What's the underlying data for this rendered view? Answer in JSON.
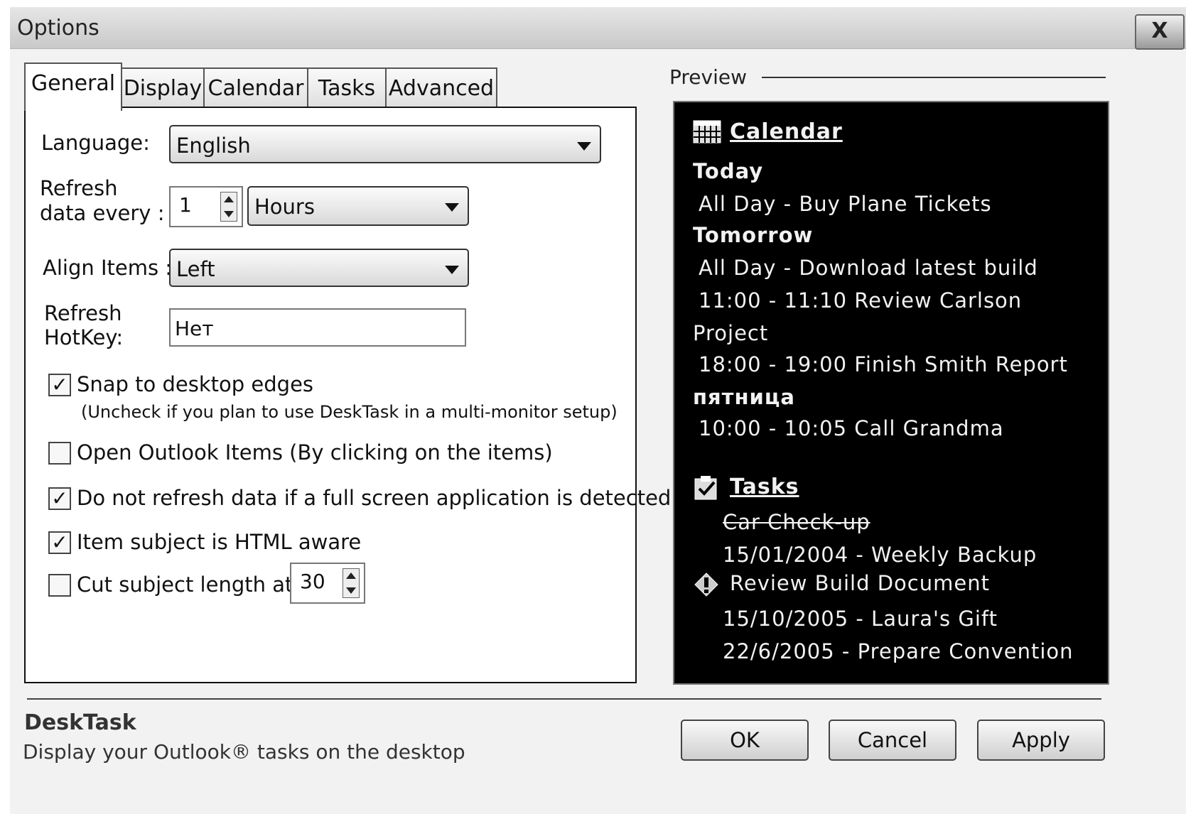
{
  "window": {
    "title": "Options",
    "close_label": "X"
  },
  "tabs": [
    {
      "label": "General"
    },
    {
      "label": "Display"
    },
    {
      "label": "Calendar"
    },
    {
      "label": "Tasks"
    },
    {
      "label": "Advanced"
    }
  ],
  "general": {
    "language_label": "Language:",
    "language_value": "English",
    "refresh_label_1": "Refresh",
    "refresh_label_2": "data every :",
    "refresh_value": "1",
    "refresh_unit": "Hours",
    "align_label": "Align Items :",
    "align_value": "Left",
    "hotkey_label_1": "Refresh",
    "hotkey_label_2": "HotKey:",
    "hotkey_value": "Нет",
    "snap_label": "Snap to desktop edges",
    "snap_checked": true,
    "snap_note": "(Uncheck if you plan to use DeskTask in a multi-monitor setup)",
    "open_outlook_label": "Open Outlook Items (By clicking on the items)",
    "open_outlook_checked": false,
    "no_refresh_label": "Do not refresh data if a full screen application is detected",
    "no_refresh_checked": true,
    "html_aware_label": "Item subject is HTML aware",
    "html_aware_checked": true,
    "cut_subject_label": "Cut subject length at:",
    "cut_subject_checked": false,
    "cut_subject_value": "30"
  },
  "preview": {
    "label": "Preview",
    "calendar_heading": "Calendar",
    "today": "Today",
    "today_item": "All Day - Buy Plane Tickets",
    "tomorrow": "Tomorrow",
    "tomorrow_item_1": "All Day - Download latest build",
    "tomorrow_item_2a": "11:00 - 11:10 Review Carlson",
    "tomorrow_item_2b": "Project",
    "tomorrow_item_3": "18:00 - 19:00 Finish Smith Report",
    "friday": "пятница",
    "friday_item": "10:00 - 10:05 Call Grandma",
    "tasks_heading": "Tasks",
    "task_1": "Car Check-up",
    "task_2": "15/01/2004 - Weekly Backup",
    "task_3": "Review Build Document",
    "task_4": "15/10/2005 - Laura's Gift",
    "task_5": "22/6/2005 - Prepare Convention"
  },
  "footer": {
    "app_name": "DeskTask",
    "description": "Display your Outlook® tasks on the desktop",
    "ok_label": "OK",
    "cancel_label": "Cancel",
    "apply_label": "Apply"
  }
}
